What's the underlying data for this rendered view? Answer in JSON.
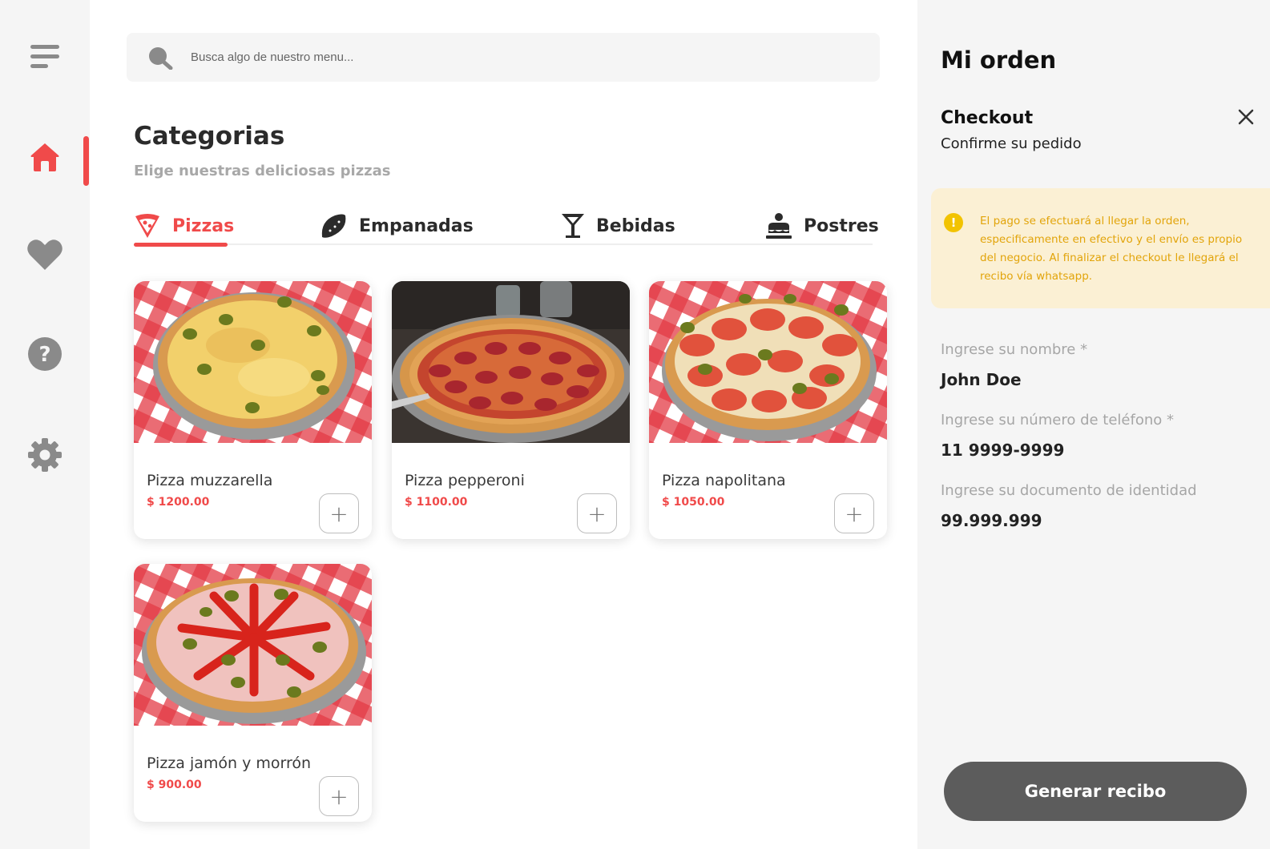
{
  "sidebar": {
    "items": [
      {
        "name": "menu",
        "icon": "menu-icon"
      },
      {
        "name": "home",
        "icon": "home-icon",
        "active": true
      },
      {
        "name": "favorites",
        "icon": "heart-icon"
      },
      {
        "name": "help",
        "icon": "help-icon"
      },
      {
        "name": "settings",
        "icon": "gear-icon"
      }
    ]
  },
  "search": {
    "placeholder": "Busca algo de nuestro menu...",
    "value": ""
  },
  "categories": {
    "title": "Categorias",
    "subtitle": "Elige nuestras deliciosas pizzas",
    "tabs": [
      {
        "label": "Pizzas",
        "icon": "pizza-slice-icon",
        "active": true
      },
      {
        "label": "Empanadas",
        "icon": "empanada-icon"
      },
      {
        "label": "Bebidas",
        "icon": "cocktail-icon"
      },
      {
        "label": "Postres",
        "icon": "cake-icon"
      }
    ]
  },
  "products": [
    {
      "name": "Pizza muzzarella",
      "price": "$ 1200.00",
      "add_label": "+"
    },
    {
      "name": "Pizza pepperoni",
      "price": "$ 1100.00",
      "add_label": "+"
    },
    {
      "name": "Pizza napolitana",
      "price": "$ 1050.00",
      "add_label": "+"
    },
    {
      "name": "Pizza jamón y morrón",
      "price": "$ 900.00",
      "add_label": "+"
    }
  ],
  "order": {
    "title": "Mi orden",
    "checkout_title": "Checkout",
    "checkout_subtitle": "Confirme su pedido",
    "notice_icon_text": "!",
    "notice": "El pago se efectuará al llegar la orden, especificamente en efectivo y el envío es propio del negocio. Al finalizar el checkout le llegará el recibo vía whatsapp.",
    "fields": [
      {
        "label": "Ingrese su nombre *",
        "value": "John Doe"
      },
      {
        "label": "Ingrese su número de teléfono *",
        "value": "11 9999-9999"
      },
      {
        "label": "Ingrese su documento de identidad",
        "value": "99.999.999"
      }
    ],
    "submit_label": "Generar recibo"
  },
  "colors": {
    "accent": "#f04a4a",
    "sidebar_bg": "#f5f5f5",
    "notice_bg": "#fbf0d4",
    "notice_text": "#e2a40a",
    "button_bg": "#5c5c5c"
  }
}
